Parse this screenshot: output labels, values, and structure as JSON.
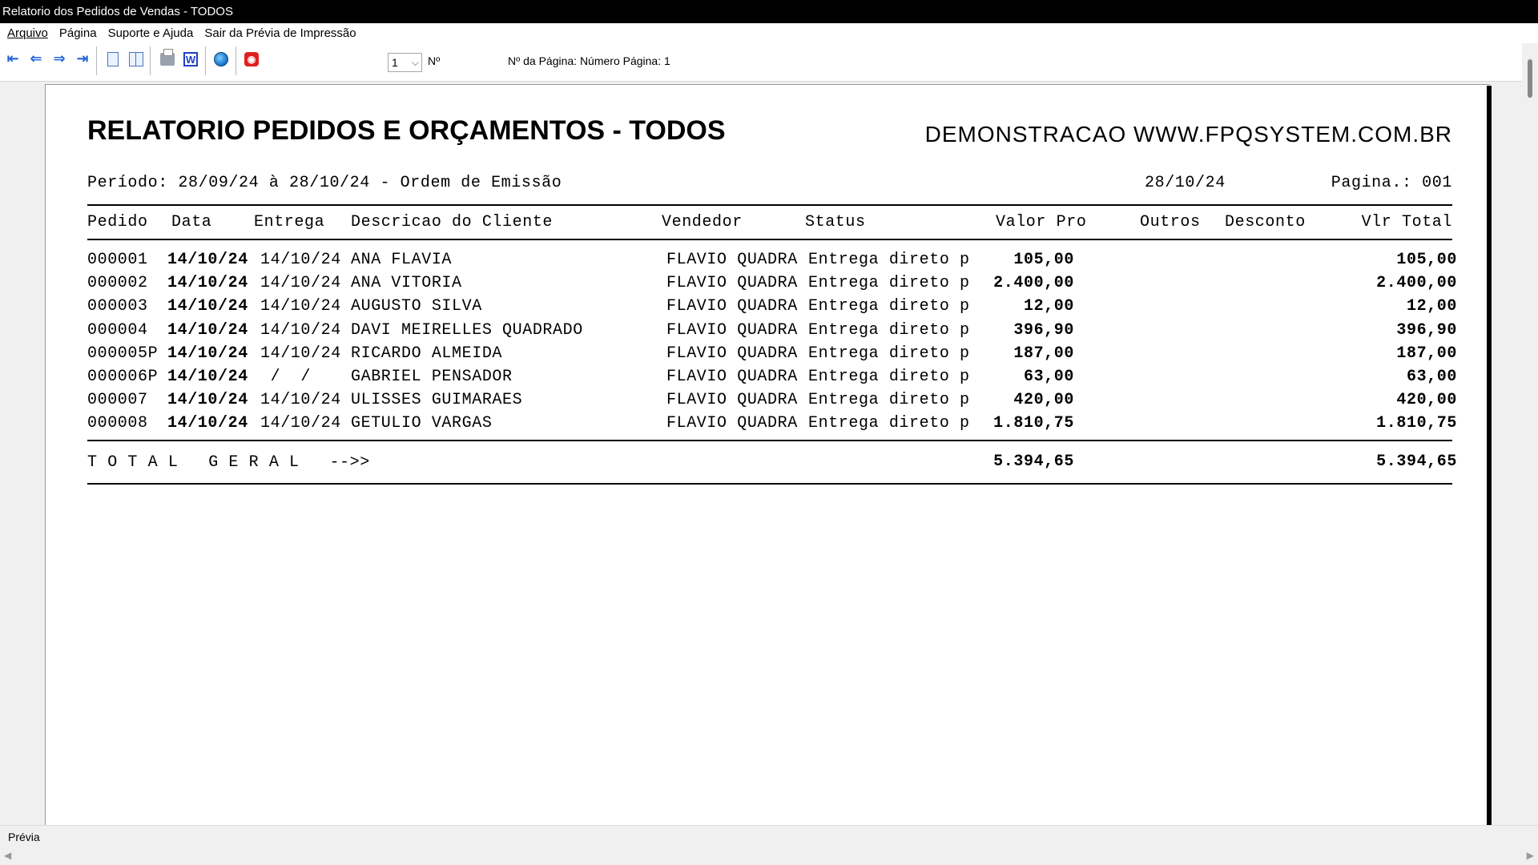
{
  "window": {
    "title": "Relatorio dos Pedidos de Vendas - TODOS"
  },
  "menu": {
    "arquivo": "Arquivo",
    "pagina": "Página",
    "suporte": "Suporte e Ajuda",
    "sair": "Sair da Prévia de Impressão"
  },
  "toolbar": {
    "page_select_value": "1",
    "page_no_label": "Nº",
    "page_status": "Nº da Página: Número Página: 1",
    "word_letter": "W",
    "icons": [
      "first-page-icon",
      "prev-page-icon",
      "next-page-icon",
      "last-page-icon",
      "single-page-icon",
      "two-pages-icon",
      "print-icon",
      "word-export-icon",
      "web-icon",
      "stop-icon"
    ]
  },
  "report": {
    "title": "RELATORIO PEDIDOS E ORÇAMENTOS - TODOS",
    "site": "DEMONSTRACAO WWW.FPQSYSTEM.COM.BR",
    "period": "Período: 28/09/24 à 28/10/24 - Ordem de Emissão",
    "date": "28/10/24",
    "page": "Pagina.: 001",
    "headers": {
      "pedido": "Pedido",
      "data": "Data",
      "entrega": "Entrega",
      "cliente": "Descricao do Cliente",
      "vendedor": "Vendedor",
      "status": "Status",
      "valor": "Valor Pro",
      "outros": "Outros",
      "desconto": "Desconto",
      "total": "Vlr Total"
    },
    "rows": [
      {
        "pedido": "000001",
        "data": "14/10/24",
        "entrega": "14/10/24",
        "cliente": "ANA FLAVIA",
        "vendedor": "FLAVIO QUADRA",
        "status": "Entrega direto p",
        "valor": "105,00",
        "total": "105,00"
      },
      {
        "pedido": "000002",
        "data": "14/10/24",
        "entrega": "14/10/24",
        "cliente": "ANA VITORIA",
        "vendedor": "FLAVIO QUADRA",
        "status": "Entrega direto p",
        "valor": "2.400,00",
        "total": "2.400,00"
      },
      {
        "pedido": "000003",
        "data": "14/10/24",
        "entrega": "14/10/24",
        "cliente": "AUGUSTO SILVA",
        "vendedor": "FLAVIO QUADRA",
        "status": "Entrega direto p",
        "valor": "12,00",
        "total": "12,00"
      },
      {
        "pedido": "000004",
        "data": "14/10/24",
        "entrega": "14/10/24",
        "cliente": "DAVI MEIRELLES QUADRADO",
        "vendedor": "FLAVIO QUADRA",
        "status": "Entrega direto p",
        "valor": "396,90",
        "total": "396,90"
      },
      {
        "pedido": "000005P",
        "data": "14/10/24",
        "entrega": "14/10/24",
        "cliente": "RICARDO ALMEIDA",
        "vendedor": "FLAVIO QUADRA",
        "status": "Entrega direto p",
        "valor": "187,00",
        "total": "187,00"
      },
      {
        "pedido": "000006P",
        "data": "14/10/24",
        "entrega": " /  /",
        "cliente": "GABRIEL PENSADOR",
        "vendedor": "FLAVIO QUADRA",
        "status": "Entrega direto p",
        "valor": "63,00",
        "total": "63,00"
      },
      {
        "pedido": "000007",
        "data": "14/10/24",
        "entrega": "14/10/24",
        "cliente": "ULISSES GUIMARAES",
        "vendedor": "FLAVIO QUADRA",
        "status": "Entrega direto p",
        "valor": "420,00",
        "total": "420,00"
      },
      {
        "pedido": "000008",
        "data": "14/10/24",
        "entrega": "14/10/24",
        "cliente": "GETULIO VARGAS",
        "vendedor": "FLAVIO QUADRA",
        "status": "Entrega direto p",
        "valor": "1.810,75",
        "total": "1.810,75"
      }
    ],
    "total_label": "T O T A L   G E R A L   -->>",
    "total_valor": "5.394,65",
    "total_total": "5.394,65"
  },
  "statusbar": {
    "text": "Prévia"
  }
}
